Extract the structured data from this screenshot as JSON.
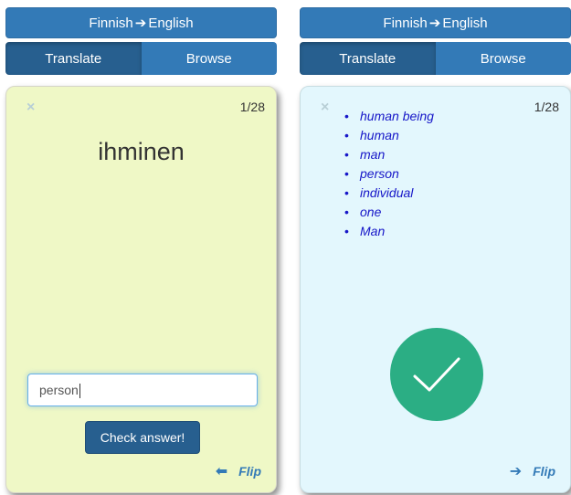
{
  "left": {
    "direction": {
      "from": "Finnish",
      "arrow": "➔",
      "to": "English"
    },
    "tabs": {
      "translate": "Translate",
      "browse": "Browse"
    },
    "card": {
      "close": "×",
      "counter": "1/28",
      "word": "ihminen",
      "answer_value": "person",
      "check_label": "Check answer!",
      "flip_arrow": "⬅",
      "flip_label": "Flip"
    }
  },
  "right": {
    "direction": {
      "from": "Finnish",
      "arrow": "➔",
      "to": "English"
    },
    "tabs": {
      "translate": "Translate",
      "browse": "Browse"
    },
    "card": {
      "close": "×",
      "counter": "1/28",
      "meanings": [
        "human being",
        "human",
        "man",
        "person",
        "individual",
        "one",
        "Man"
      ],
      "flip_arrow": "➔",
      "flip_label": "Flip"
    }
  },
  "colors": {
    "primary": "#337ab7",
    "active": "#275f8f",
    "front_card": "#eff8c6",
    "back_card": "#e3f7fd",
    "correct": "#2bae84",
    "meaning_text": "#1616c8"
  },
  "icons": {
    "close": "close-icon",
    "correct": "checkmark-icon",
    "flip_back": "arrow-left-icon",
    "flip_forward": "arrow-right-icon"
  }
}
